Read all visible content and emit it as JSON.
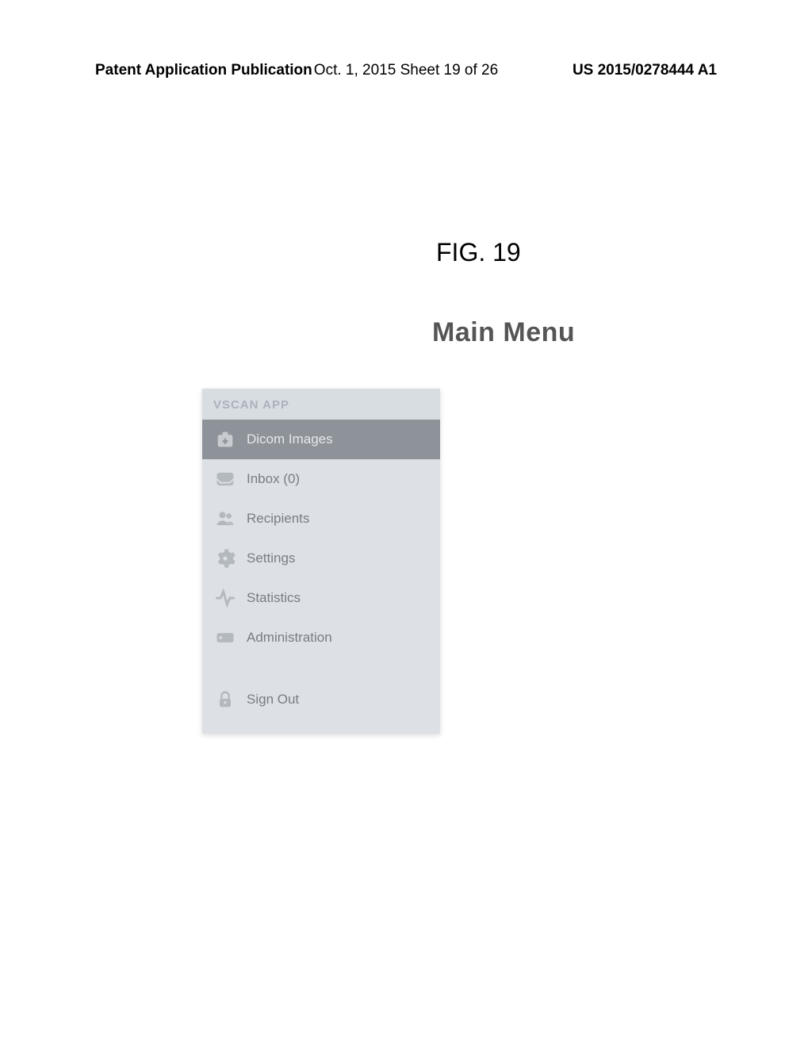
{
  "header": {
    "left": "Patent Application Publication",
    "center": "Oct. 1, 2015  Sheet 19 of 26",
    "right": "US 2015/0278444 A1"
  },
  "figure": {
    "label": "FIG. 19",
    "title": "Main Menu"
  },
  "menu": {
    "title": "VSCAN APP",
    "items": [
      {
        "label": "Dicom Images",
        "active": true,
        "icon": "medkit-icon"
      },
      {
        "label": "Inbox (0)",
        "active": false,
        "icon": "inbox-icon"
      },
      {
        "label": "Recipients",
        "active": false,
        "icon": "people-icon"
      },
      {
        "label": "Settings",
        "active": false,
        "icon": "gear-icon"
      },
      {
        "label": "Statistics",
        "active": false,
        "icon": "pulse-icon"
      },
      {
        "label": "Administration",
        "active": false,
        "icon": "tag-icon"
      }
    ],
    "signout": {
      "label": "Sign Out",
      "icon": "lock-icon"
    }
  }
}
